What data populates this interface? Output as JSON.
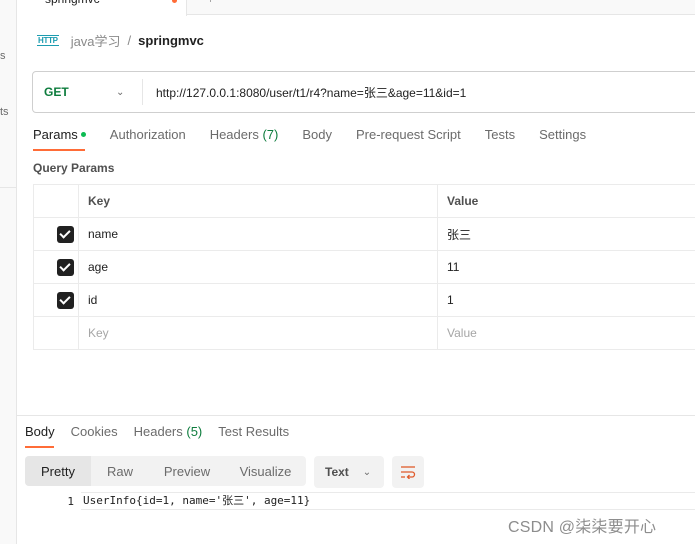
{
  "sidebar": {
    "fragments": [
      "s",
      "ts"
    ]
  },
  "tabs": {
    "active_tab_label": "springmvc",
    "next_tab_label": "+"
  },
  "breadcrumb": {
    "icon": "http-icon",
    "icon_text": "HTTP",
    "parent": "java学习",
    "separator": "/",
    "current": "springmvc"
  },
  "request": {
    "method": "GET",
    "url": "http://127.0.0.1:8080/user/t1/r4?name=张三&age=11&id=1",
    "method_color": "#0d7c3d"
  },
  "request_tabs": [
    {
      "label": "Params",
      "active": true,
      "indicator": "green-dot"
    },
    {
      "label": "Authorization"
    },
    {
      "label": "Headers",
      "count": "(7)"
    },
    {
      "label": "Body"
    },
    {
      "label": "Pre-request Script"
    },
    {
      "label": "Tests"
    },
    {
      "label": "Settings"
    }
  ],
  "query_params": {
    "title": "Query Params",
    "columns": [
      "Key",
      "Value"
    ],
    "rows": [
      {
        "checked": true,
        "key": "name",
        "value": "张三"
      },
      {
        "checked": true,
        "key": "age",
        "value": "11"
      },
      {
        "checked": true,
        "key": "id",
        "value": "1"
      }
    ],
    "placeholder_key": "Key",
    "placeholder_value": "Value"
  },
  "response_tabs": [
    {
      "label": "Body",
      "active": true
    },
    {
      "label": "Cookies"
    },
    {
      "label": "Headers",
      "count": "(5)"
    },
    {
      "label": "Test Results"
    }
  ],
  "response_view": {
    "modes": [
      "Pretty",
      "Raw",
      "Preview",
      "Visualize"
    ],
    "active_mode": "Pretty",
    "format": "Text",
    "wrap_icon": "wrap-lines-icon"
  },
  "response_body": {
    "lines": [
      {
        "no": "1",
        "text": "UserInfo{id=1, name='张三', age=11}"
      }
    ]
  },
  "watermark": "CSDN @柒柒要开心",
  "colors": {
    "accent": "#ff6c37",
    "success": "#0cbb52",
    "count_green": "#0d7c3d"
  }
}
